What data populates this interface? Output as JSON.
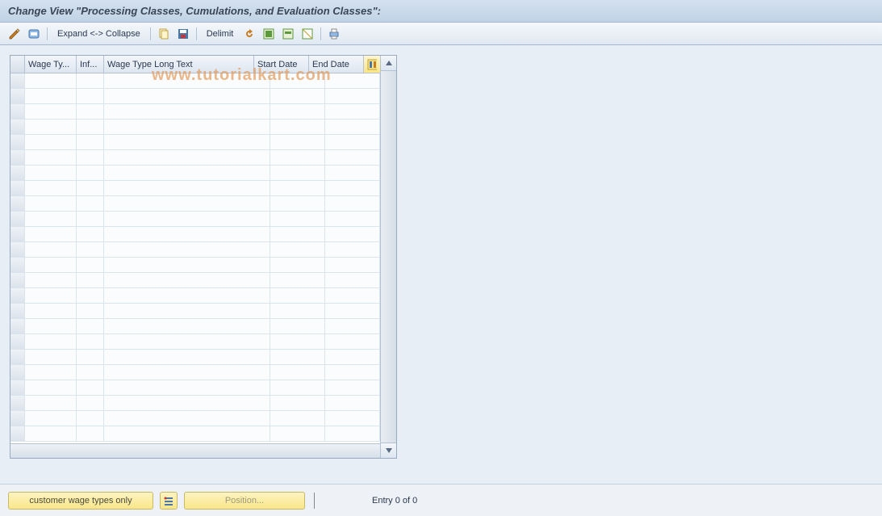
{
  "title": "Change View \"Processing Classes, Cumulations, and Evaluation Classes\":",
  "toolbar": {
    "expand_collapse": "Expand <-> Collapse",
    "delimit": "Delimit"
  },
  "table": {
    "columns": {
      "wage_type": "Wage Ty...",
      "inf": "Inf...",
      "long_text": "Wage Type Long Text",
      "start_date": "Start Date",
      "end_date": "End Date"
    },
    "row_count": 24,
    "rows": []
  },
  "footer": {
    "btn_customer": "customer wage types only",
    "btn_position": "Position...",
    "entry_text": "Entry 0 of 0"
  },
  "watermark": "www.tutorialkart.com"
}
